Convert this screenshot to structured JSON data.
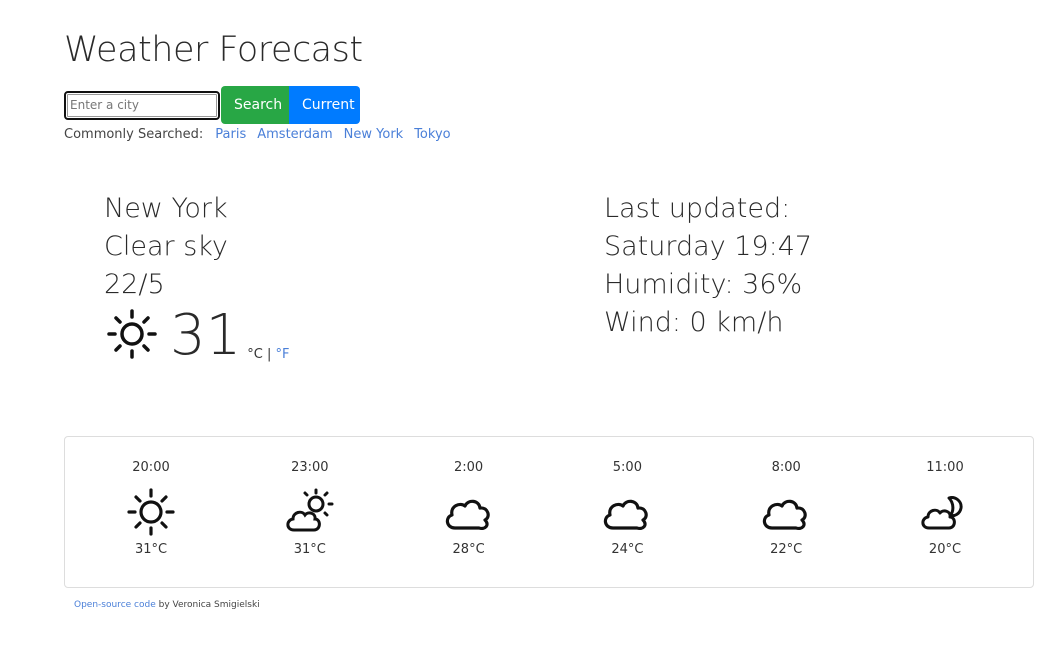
{
  "header": {
    "title": "Weather Forecast"
  },
  "search": {
    "placeholder": "Enter a city",
    "search_label": "Search",
    "current_label": "Current"
  },
  "commonly": {
    "label": "Commonly Searched:",
    "cities": [
      "Paris",
      "Amsterdam",
      "New York",
      "Tokyo"
    ]
  },
  "current": {
    "city": "New York",
    "description": "Clear sky",
    "date": "22/5",
    "temperature": "31",
    "icon": "sun-icon",
    "unit_c": "°C",
    "unit_sep": " | ",
    "unit_f": "°F"
  },
  "details": {
    "last_updated_label": "Last updated:",
    "last_updated": "Saturday 19:47",
    "humidity": "Humidity: 36%",
    "wind": "Wind: 0 km/h"
  },
  "forecast": [
    {
      "time": "20:00",
      "temp": "31°C",
      "icon": "sun-icon"
    },
    {
      "time": "23:00",
      "temp": "31°C",
      "icon": "partly-cloudy-icon"
    },
    {
      "time": "2:00",
      "temp": "28°C",
      "icon": "cloud-icon"
    },
    {
      "time": "5:00",
      "temp": "24°C",
      "icon": "cloud-icon"
    },
    {
      "time": "8:00",
      "temp": "22°C",
      "icon": "cloud-icon"
    },
    {
      "time": "11:00",
      "temp": "20°C",
      "icon": "cloud-moon-icon"
    }
  ],
  "footer": {
    "link_text": "Open-source code",
    "suffix": " by Veronica Smigielski"
  },
  "colors": {
    "search_button": "#28a745",
    "current_button": "#007bff",
    "link": "#4a7fd8"
  }
}
